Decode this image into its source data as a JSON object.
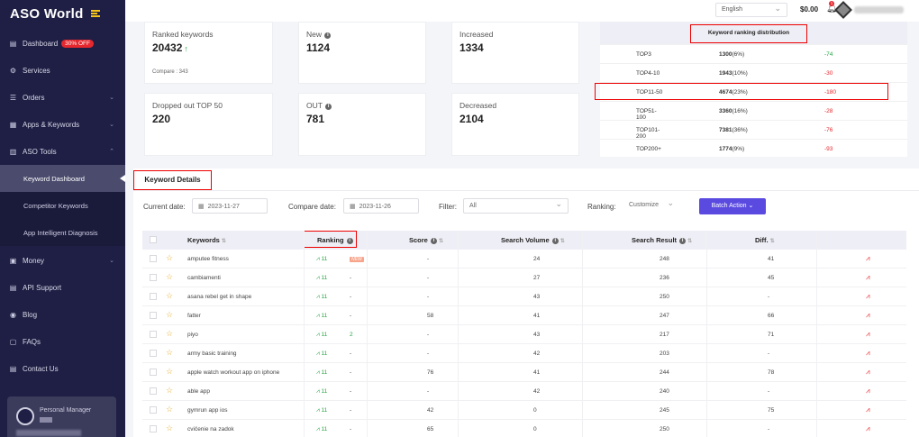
{
  "app": {
    "logo": "ASO World"
  },
  "sidebar": {
    "items": [
      {
        "label": "Dashboard",
        "badge": "30% OFF",
        "icon": "dashboard-icon"
      },
      {
        "label": "Services",
        "icon": "services-icon"
      },
      {
        "label": "Orders",
        "icon": "orders-icon"
      },
      {
        "label": "Apps & Keywords",
        "icon": "apps-icon"
      },
      {
        "label": "ASO Tools",
        "icon": "tools-icon"
      },
      {
        "label": "Money",
        "icon": "money-icon"
      },
      {
        "label": "API Support",
        "icon": "api-icon"
      },
      {
        "label": "Blog",
        "icon": "blog-icon"
      },
      {
        "label": "FAQs",
        "icon": "faq-icon"
      },
      {
        "label": "Contact Us",
        "icon": "contact-icon"
      }
    ],
    "subitems": [
      "Keyword Dashboard",
      "Competitor Keywords",
      "App Intelligent Diagnosis"
    ],
    "personal_manager": "Personal Manager"
  },
  "topbar": {
    "language": "English",
    "balance": "$0.00",
    "notifications": "1"
  },
  "stats": {
    "ranked": {
      "label": "Ranked keywords",
      "value": "20432",
      "compare": "Compare : 343"
    },
    "new": {
      "label": "New",
      "value": "1124"
    },
    "increased": {
      "label": "Increased",
      "value": "1334"
    },
    "dropped": {
      "label": "Dropped out TOP 50",
      "value": "220"
    },
    "out": {
      "label": "OUT",
      "value": "781"
    },
    "decreased": {
      "label": "Decreased",
      "value": "2104"
    }
  },
  "distribution": {
    "title": "Keyword ranking distribution",
    "rows": [
      {
        "range": "TOP3",
        "count": "1300",
        "pct": "(6%)",
        "delta": "-74",
        "dir": "pos"
      },
      {
        "range": "TOP4-10",
        "count": "1943",
        "pct": "(10%)",
        "delta": "-30",
        "dir": "neg"
      },
      {
        "range": "TOP11-50",
        "count": "4674",
        "pct": "(23%)",
        "delta": "-180",
        "dir": "neg"
      },
      {
        "range": "TOP51-100",
        "count": "3360",
        "pct": "(16%)",
        "delta": "-28",
        "dir": "neg"
      },
      {
        "range": "TOP101-200",
        "count": "7381",
        "pct": "(36%)",
        "delta": "-76",
        "dir": "neg"
      },
      {
        "range": "TOP200+",
        "count": "1774",
        "pct": "(9%)",
        "delta": "-93",
        "dir": "neg"
      }
    ]
  },
  "details": {
    "title": "Keyword Details",
    "current_label": "Current date:",
    "current_date": "2023-11-27",
    "compare_label": "Compare date:",
    "compare_date": "2023-11-26",
    "filter_label": "Filter:",
    "filter_value": "All",
    "ranking_label": "Ranking:",
    "ranking_value": "Customize",
    "batch": "Batch Action ⌄"
  },
  "table": {
    "headers": [
      "Keywords",
      "Ranking",
      "Score",
      "Search Volume",
      "Search Result",
      "Diff."
    ],
    "rows": [
      {
        "kw": "amputee fitness",
        "rank": "11",
        "change": "NEW",
        "score": "-",
        "vol": "24",
        "result": "248",
        "diff": "41"
      },
      {
        "kw": "cambiamenti",
        "rank": "11",
        "change": "-",
        "score": "-",
        "vol": "27",
        "result": "236",
        "diff": "45"
      },
      {
        "kw": "asana rebel get in shape",
        "rank": "11",
        "change": "-",
        "score": "-",
        "vol": "43",
        "result": "250",
        "diff": "-"
      },
      {
        "kw": "fatter",
        "rank": "11",
        "change": "-",
        "score": "58",
        "vol": "41",
        "result": "247",
        "diff": "66"
      },
      {
        "kw": "piyo",
        "rank": "11",
        "change": "2",
        "score": "-",
        "vol": "43",
        "result": "217",
        "diff": "71"
      },
      {
        "kw": "army basic training",
        "rank": "11",
        "change": "-",
        "score": "-",
        "vol": "42",
        "result": "203",
        "diff": "-"
      },
      {
        "kw": "apple watch workout app on iphone",
        "rank": "11",
        "change": "-",
        "score": "76",
        "vol": "41",
        "result": "244",
        "diff": "78"
      },
      {
        "kw": "able app",
        "rank": "11",
        "change": "-",
        "score": "-",
        "vol": "42",
        "result": "240",
        "diff": "-"
      },
      {
        "kw": "gymrun app ios",
        "rank": "11",
        "change": "-",
        "score": "42",
        "vol": "0",
        "result": "245",
        "diff": "75"
      },
      {
        "kw": "cvičenie na zadok",
        "rank": "11",
        "change": "-",
        "score": "65",
        "vol": "0",
        "result": "250",
        "diff": "-"
      }
    ]
  }
}
